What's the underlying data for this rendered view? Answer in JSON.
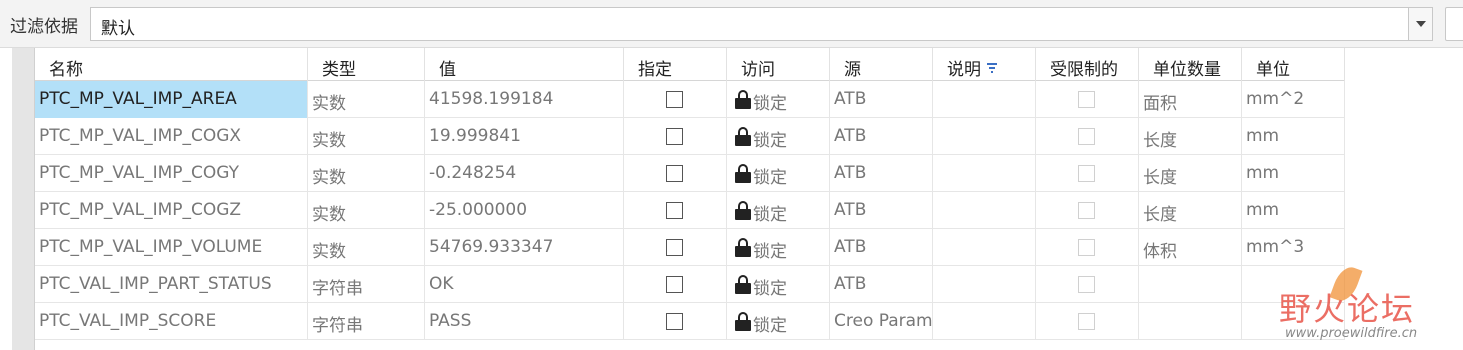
{
  "filter": {
    "label": "过滤依据",
    "value": "默认"
  },
  "columns": [
    "名称",
    "类型",
    "值",
    "指定",
    "访问",
    "源",
    "说明",
    "受限制的",
    "单位数量",
    "单位"
  ],
  "rows": [
    {
      "name": "PTC_MP_VAL_IMP_AREA",
      "type": "实数",
      "value": "41598.199184",
      "access": "锁定",
      "source": "ATB",
      "quantity": "面积",
      "unit": "mm^2",
      "selected": true
    },
    {
      "name": "PTC_MP_VAL_IMP_COGX",
      "type": "实数",
      "value": "19.999841",
      "access": "锁定",
      "source": "ATB",
      "quantity": "长度",
      "unit": "mm"
    },
    {
      "name": "PTC_MP_VAL_IMP_COGY",
      "type": "实数",
      "value": "-0.248254",
      "access": "锁定",
      "source": "ATB",
      "quantity": "长度",
      "unit": "mm"
    },
    {
      "name": "PTC_MP_VAL_IMP_COGZ",
      "type": "实数",
      "value": "-25.000000",
      "access": "锁定",
      "source": "ATB",
      "quantity": "长度",
      "unit": "mm"
    },
    {
      "name": "PTC_MP_VAL_IMP_VOLUME",
      "type": "实数",
      "value": "54769.933347",
      "access": "锁定",
      "source": "ATB",
      "quantity": "体积",
      "unit": "mm^3"
    },
    {
      "name": "PTC_VAL_IMP_PART_STATUS",
      "type": "字符串",
      "value": "OK",
      "access": "锁定",
      "source": "ATB",
      "quantity": "",
      "unit": ""
    },
    {
      "name": "PTC_VAL_IMP_SCORE",
      "type": "字符串",
      "value": "PASS",
      "access": "锁定",
      "source": "Creo Param",
      "quantity": "",
      "unit": ""
    }
  ],
  "watermark": {
    "text": "野火论坛",
    "url": "www.proewildfire.cn"
  }
}
